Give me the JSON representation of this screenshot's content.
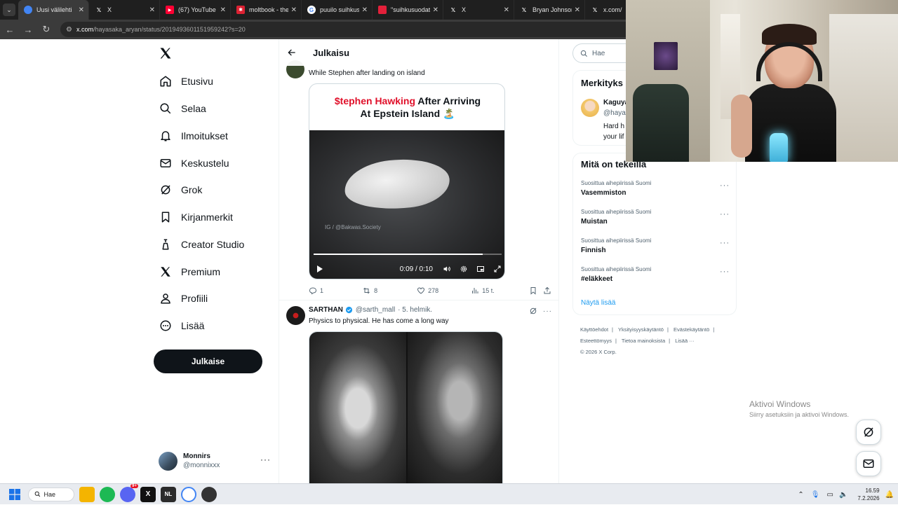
{
  "browser": {
    "tabs": [
      {
        "title": "Uusi välilehti",
        "icon": "chrome-icon",
        "active": true
      },
      {
        "title": "X",
        "icon": "x-logo-icon"
      },
      {
        "title": "(67) YouTube",
        "icon": "youtube-icon"
      },
      {
        "title": "moltbook - the",
        "icon": "moltbook-icon"
      },
      {
        "title": "puuilo suihkus",
        "icon": "google-icon"
      },
      {
        "title": "\"suihkusuodati",
        "icon": "shop-icon"
      },
      {
        "title": "X",
        "icon": "x-logo-icon"
      },
      {
        "title": "Bryan Johnson",
        "icon": "x-logo-icon"
      },
      {
        "title": "x.com/Shin",
        "icon": "x-logo-icon"
      }
    ],
    "url_host": "x.com",
    "url_path": "/hayasaka_aryan/status/2019493601151959242?s=20"
  },
  "nav": {
    "items": [
      {
        "label": "Etusivu",
        "icon": "home-icon"
      },
      {
        "label": "Selaa",
        "icon": "search-icon"
      },
      {
        "label": "Ilmoitukset",
        "icon": "bell-icon"
      },
      {
        "label": "Keskustelu",
        "icon": "mail-icon"
      },
      {
        "label": "Grok",
        "icon": "grok-icon"
      },
      {
        "label": "Kirjanmerkit",
        "icon": "bookmark-icon"
      },
      {
        "label": "Creator Studio",
        "icon": "creator-studio-icon"
      },
      {
        "label": "Premium",
        "icon": "x-logo-icon"
      },
      {
        "label": "Profiili",
        "icon": "person-icon"
      },
      {
        "label": "Lisää",
        "icon": "more-circle-icon"
      }
    ],
    "post_label": "Julkaise",
    "account": {
      "name": "Monnirs",
      "handle": "@monnixxx"
    }
  },
  "main": {
    "header_title": "Julkaisu",
    "tweet1": {
      "text": "While Stephen after landing on island",
      "video_caption_red": "$tephen Hawking",
      "video_caption_rest": " After Arriving",
      "video_caption_line2": "At Epstein Island 🏝️",
      "video_watermark": "IG / @Bakwas.Society",
      "video_time": "0:09 / 0:10",
      "video_progress": 0.9,
      "replies": "1",
      "reposts": "8",
      "likes": "278",
      "views": "15 t."
    },
    "tweet2": {
      "name": "SARTHAN",
      "handle": "@sarth_mall",
      "date": "· 5. helmik.",
      "text": "Physics to physical. He has come a long way"
    }
  },
  "right": {
    "search_placeholder": "Hae",
    "relevant": {
      "title": "Merkityks",
      "name": "Kaguya",
      "handle": "@hayas",
      "bio_line1": "Hard h",
      "bio_line2": "your lif"
    },
    "trends_title": "Mitä on tekeillä",
    "trends": [
      {
        "context": "Suosittua aihepiirissä Suomi",
        "name": "Vasemmiston"
      },
      {
        "context": "Suosittua aihepiirissä Suomi",
        "name": "Muistan"
      },
      {
        "context": "Suosittua aihepiirissä Suomi",
        "name": "Finnish"
      },
      {
        "context": "Suosittua aihepiirissä Suomi",
        "name": "#eläkkeet"
      }
    ],
    "show_more": "Näytä lisää",
    "footer": [
      "Käyttöehdot",
      "Yksityisyyskäytäntö",
      "Evästekäytäntö",
      "Esteettömyys",
      "Tietoa mainoksista",
      "Lisää ···",
      "© 2026 X Corp."
    ]
  },
  "windows": {
    "activate_title": "Aktivoi Windows",
    "activate_sub": "Siirry asetuksiin ja aktivoi Windows.",
    "search_label": "Hae",
    "time": "16.59",
    "date": "7.2.2026",
    "badge": "9+"
  }
}
